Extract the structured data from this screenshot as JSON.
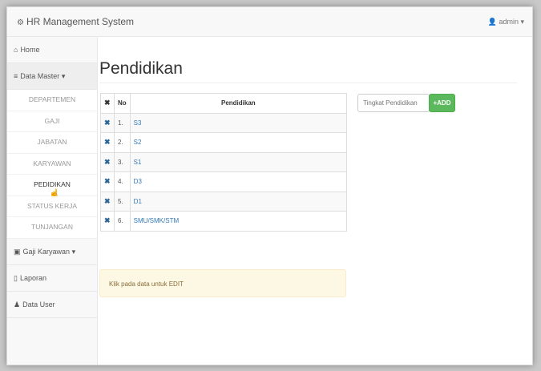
{
  "app": {
    "brand": "HR Management System",
    "brand_icon": "cogs-icon",
    "user": "admin",
    "user_caret": "▾"
  },
  "sidebar": {
    "home": "Home",
    "data_master": "Data Master",
    "data_master_caret": "▾",
    "submenu": [
      "DEPARTEMEN",
      "GAJI",
      "JABATAN",
      "KARYAWAN",
      "PEDIDIKAN",
      "STATUS KERJA",
      "TUNJANGAN"
    ],
    "current_submenu": "PEDIDIKAN",
    "gaji_karyawan": "Gaji Karyawan",
    "gaji_karyawan_caret": "▾",
    "laporan": "Laporan",
    "data_user": "Data User"
  },
  "page": {
    "title": "Pendidikan"
  },
  "table": {
    "headers": {
      "no": "No",
      "pendidikan": "Pendidikan"
    },
    "rows": [
      {
        "no": "1.",
        "pendidikan": "S3"
      },
      {
        "no": "2.",
        "pendidikan": "S2"
      },
      {
        "no": "3.",
        "pendidikan": "S1"
      },
      {
        "no": "4.",
        "pendidikan": "D3"
      },
      {
        "no": "5.",
        "pendidikan": "D1"
      },
      {
        "no": "6.",
        "pendidikan": "SMU/SMK/STM"
      }
    ]
  },
  "form": {
    "placeholder": "Tingkat Pendidikan",
    "add_label": "ADD"
  },
  "hint": "Klik pada data untuk EDIT",
  "colors": {
    "accent": "#337ab7",
    "success": "#5cb85c",
    "warning_bg": "#fcf8e3"
  }
}
